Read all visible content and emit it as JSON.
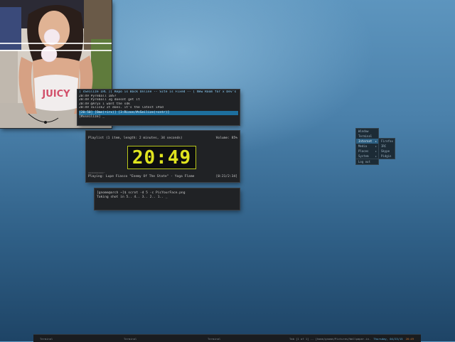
{
  "irc": {
    "topic": "[ sSeilize IRC ][ Repo is Back Online --  Site is Fixed -- [ New Room for x Dev's Join #b",
    "lines": [
      "20:49   Pyreball  1BS?",
      "20:49   Pyreball  3g doesnt get it",
      "20:49  @Aryx  i want the sdk",
      "20:49   sElisk2  It does. it's the latest iPod"
    ],
    "status": " [20:50]  [Ome(+irx)]  [3:Rizon/#sSeilize(+cntr)]",
    "input": "[#xseilize] _"
  },
  "mpd": {
    "playlist": "Playlist (1 item, length: 2 minutes, 34 seconds)",
    "volume": "Volume: 85%",
    "time": "20:49",
    "dashes": "=========-",
    "playing": "Playing: Lupe Fiasco \"Enemy Of The State\" - Yoga Flame",
    "elapsed": "[0:21/2:34]"
  },
  "terminal": {
    "command": "[gnome@arch ~]$ scrot -d 5 -c PicYourFace.png",
    "output": "Taking shot in 5.. 4.. 3.. 2.. 1.. _"
  },
  "menu": {
    "items": [
      "Window",
      "Terminal",
      "Internet",
      "Media",
      "Places",
      "System",
      "Log out"
    ],
    "submenu": [
      "Firefox",
      "IRC",
      "Skype",
      "Pidgin"
    ]
  },
  "taskbar": {
    "tasks": [
      "Terminal",
      "Terminal",
      "Terminal"
    ],
    "path": "Tab [1 of 1] -- [home/gnome/Pictures/Wallpaper.in...",
    "date": "Thursday, 04/23/15",
    "time": "20:49"
  },
  "colors": {
    "accent": "#2c5f82",
    "clock_digits": "#dfe31f",
    "irc_topic": "#8fd4ff"
  }
}
